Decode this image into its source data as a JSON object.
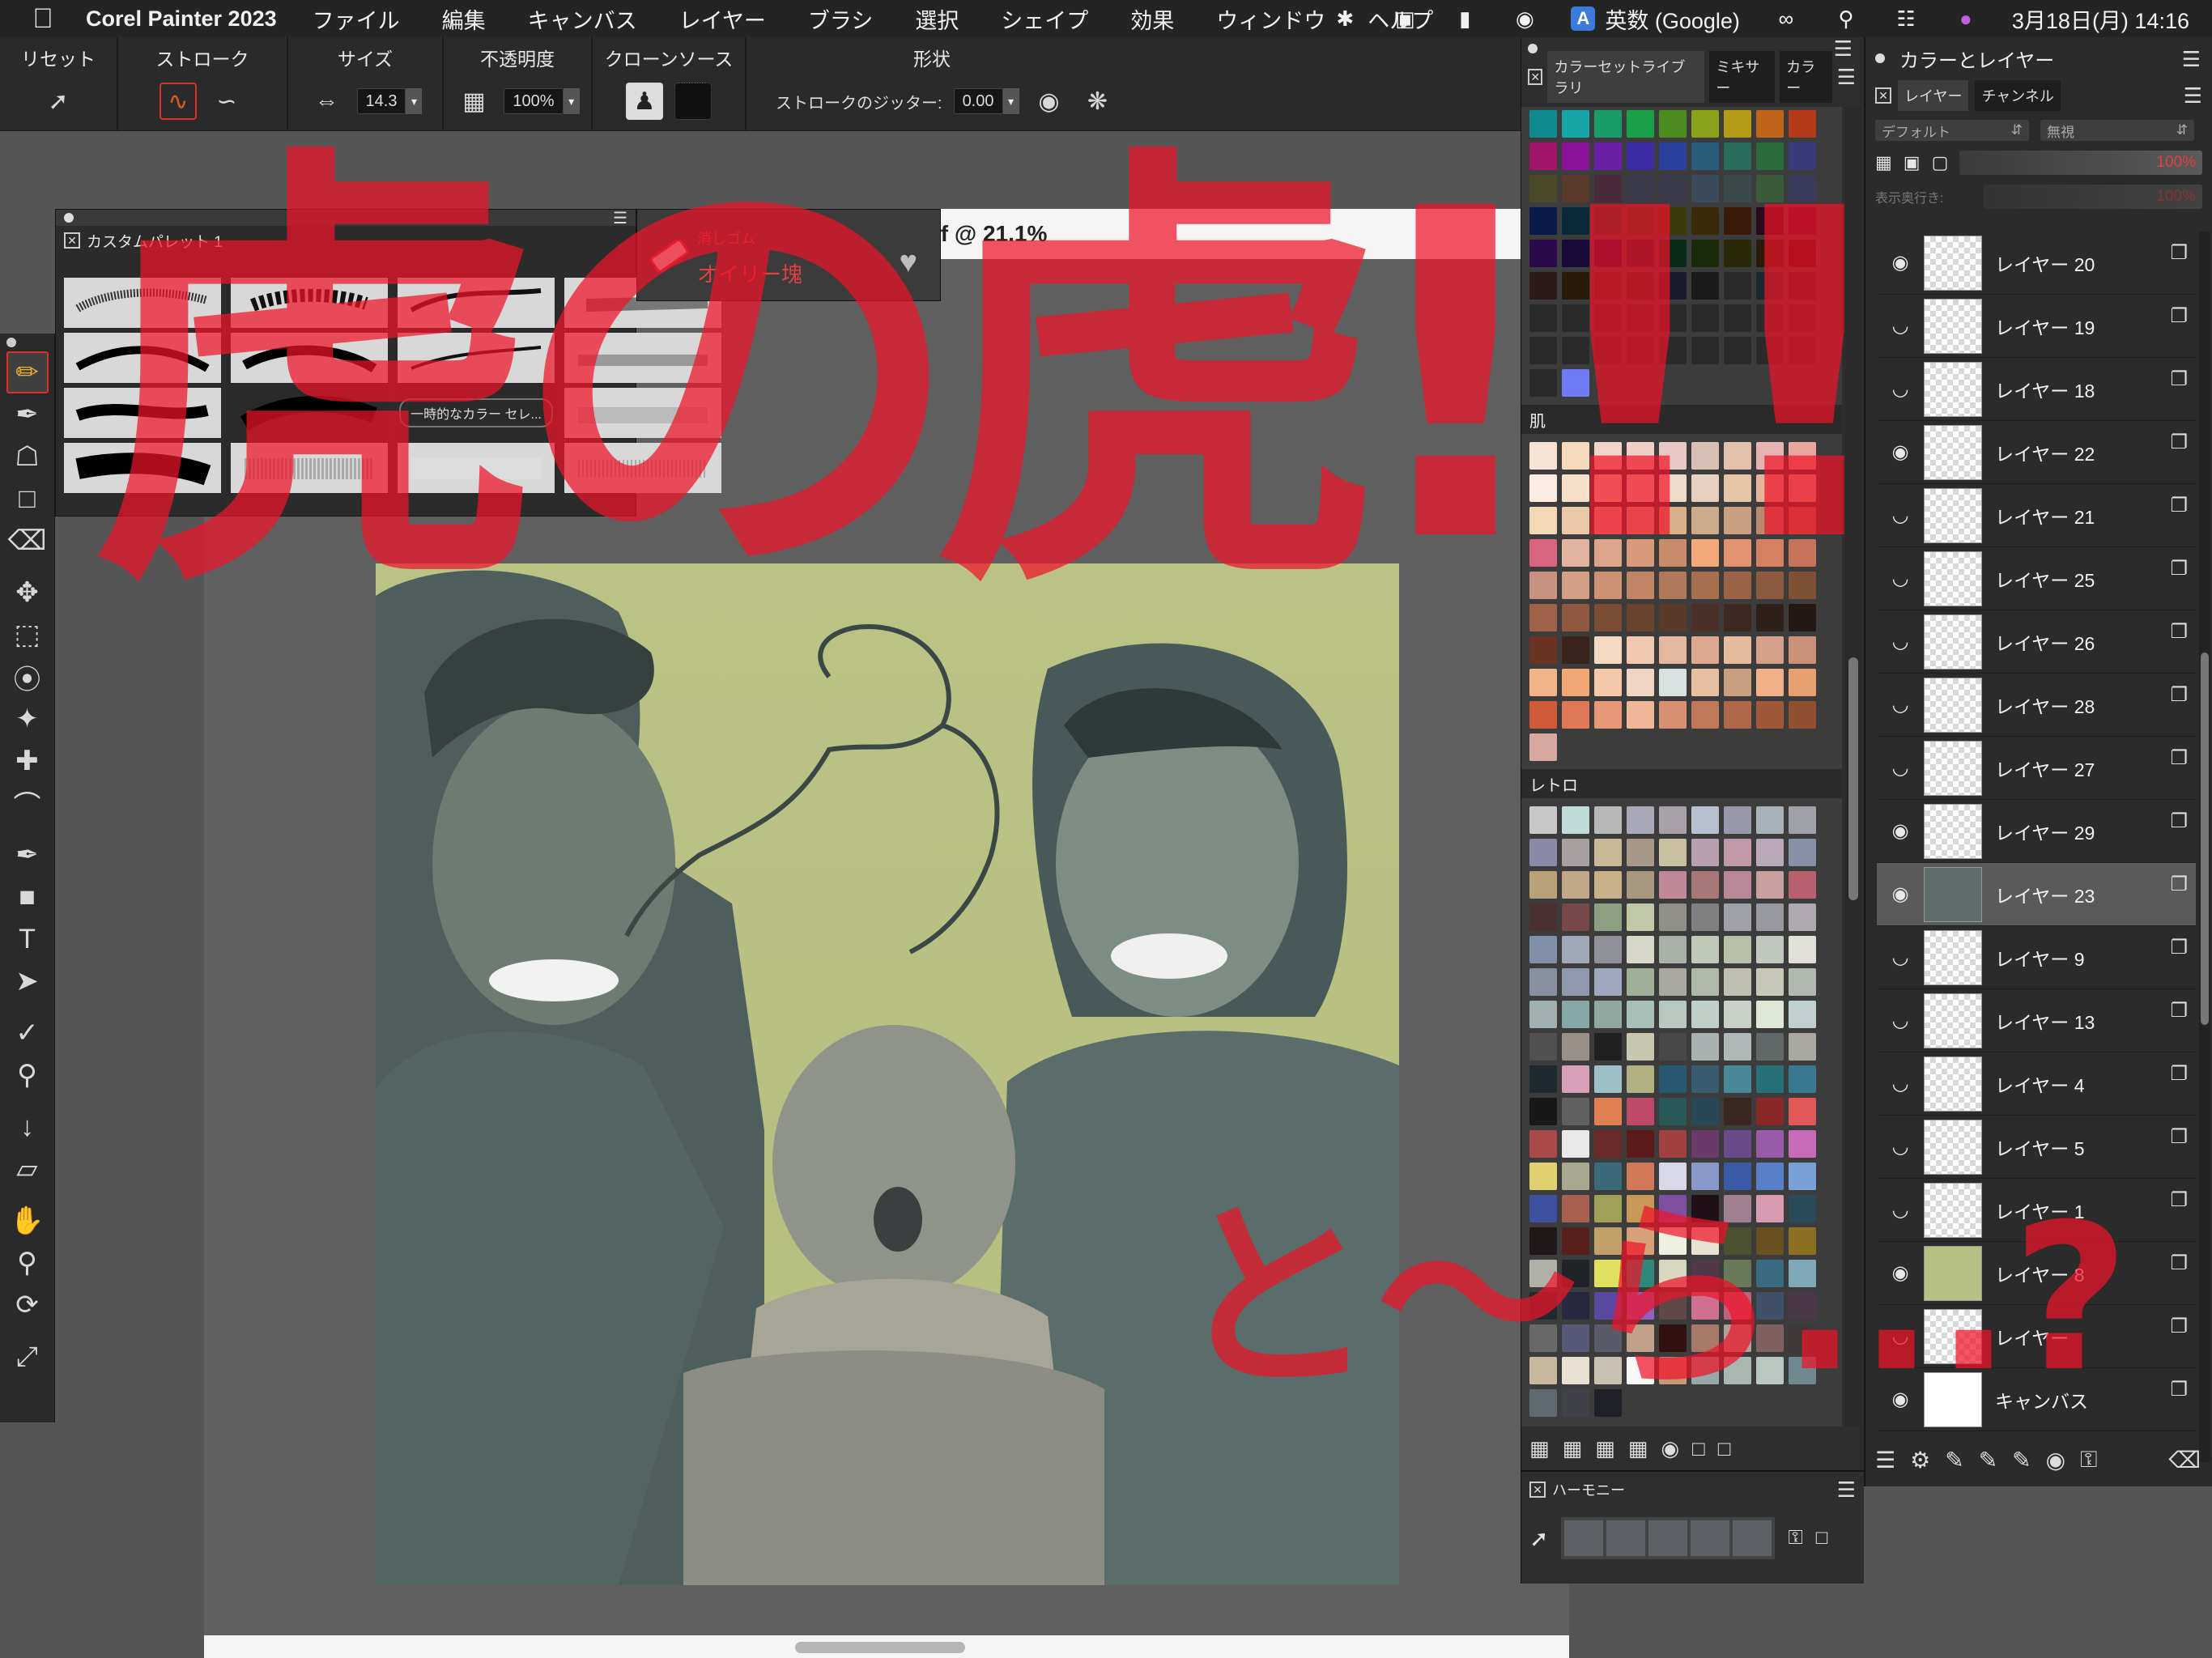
{
  "menubar": {
    "app_name": "Corel Painter 2023",
    "items": [
      "ファイル",
      "編集",
      "キャンバス",
      "レイヤー",
      "ブラシ",
      "選択",
      "シェイプ",
      "効果",
      "ウィンドウ",
      "ヘルプ"
    ],
    "ime_badge": "A",
    "ime_label": "英数 (Google)",
    "datetime": "3月18日(月)  14:16"
  },
  "property_bar": {
    "reset": "リセット",
    "stroke": "ストローク",
    "size": "サイズ",
    "size_value": "14.3",
    "opacity": "不透明度",
    "opacity_value": "100%",
    "clone_source": "クローンソース",
    "shape": "形状",
    "jitter_label": "ストロークのジッター:",
    "jitter_value": "0.00"
  },
  "custom_palette": {
    "title": "カスタムパレット 1",
    "button_label": "一時的なカラー セレ..."
  },
  "brush_selector": {
    "category": "消しゴム",
    "variant": "オイリー塊"
  },
  "document": {
    "title_fragment": "if @ 21.1%"
  },
  "color_library": {
    "tabs": [
      "カラーセットライブラリ",
      "ミキサー",
      "カラー"
    ],
    "section_skin": "肌",
    "section_retro": "レトロ",
    "colors": {
      "top": [
        "#0f8a8f",
        "#17a5a8",
        "#1a9b6a",
        "#1aa049",
        "#4d8c1f",
        "#8aa11a",
        "#b39b18",
        "#c1651a",
        "#b53a1a",
        "#a0146a",
        "#8a1499",
        "#6b1ea6",
        "#3d2ba6",
        "#2b3f9c",
        "#2a5c7c",
        "#2a6c5c",
        "#2a6c3c",
        "#3a3a7a",
        "#4a4a2a",
        "#5a3a2a",
        "#4a2a3a",
        "#3a3a4a",
        "#3a3a4a",
        "#3a4a5a",
        "#3a4a4a",
        "#3a5a3a",
        "#3a3a5a",
        "#0a1a4a",
        "#0a2a3a",
        "#0a3a2a",
        "#1a3a0a",
        "#3a3a0a",
        "#3a2a0a",
        "#3a1a0a",
        "#2a0a1a",
        "#3a0a2a",
        "#2a0a4a",
        "#1a0a3a",
        "#0a0a3a",
        "#0a1a2a",
        "#0a2a1a",
        "#1a2a0a",
        "#2a2a0a",
        "#2a1a0a",
        "#2a0a0a",
        "#2a1a1a",
        "#2a1a0a",
        "#2a2a1a",
        "#1a2a1a",
        "#1a1a2a",
        "#1a1a1a",
        "#2a2a2a",
        "#1a2a2a",
        "#2a1a2a",
        "#2a2a2a",
        "#2a2a2a",
        "#2a2a2a",
        "#2a2a2a",
        "#2a2a2a",
        "#2a2a2a",
        "#2a2a2a",
        "#2a2a2a",
        "#2a2a2a",
        "#2a2a2a",
        "#2a2a2a",
        "#2a2a2a",
        "#2a2a2a",
        "#2a2a2a",
        "#2a2a2a",
        "#2a2a2a",
        "#2a2a2a",
        "#2a2a2a",
        "#2a2a2a",
        "#6f7cf5"
      ],
      "skin": [
        "#f6e3d4",
        "#f5d9bd",
        "#f2d5c8",
        "#f0cfc6",
        "#e9c8c3",
        "#d9c0b4",
        "#e2c1ad",
        "#e6b3b3",
        "#e9a7a0",
        "#fbebe0",
        "#f7dec8",
        "#f4e6c0",
        "#f2dcc1",
        "#eedac8",
        "#e8d0c0",
        "#e6c6a8",
        "#e4b39a",
        "#ddb69c",
        "#f3d7b6",
        "#ecc9a6",
        "#e7c3a0",
        "#e1bfa0",
        "#d8b08a",
        "#ccaa8c",
        "#c9a082",
        "#b98a70",
        "#a57a5c",
        "#d8647f",
        "#e1b3a0",
        "#dca48a",
        "#d89a7a",
        "#c98c6a",
        "#f3a97a",
        "#e29270",
        "#d68062",
        "#c6735a",
        "#c89282",
        "#d3a085",
        "#cd9272",
        "#c18566",
        "#b07a5a",
        "#a6704e",
        "#9b6446",
        "#8c5a3e",
        "#7e5036",
        "#a0634a",
        "#8e573e",
        "#7c4d36",
        "#6a432e",
        "#58392a",
        "#4a3026",
        "#3c2820",
        "#30201a",
        "#241814",
        "#6a3222",
        "#3a241c",
        "#f3d8c4",
        "#f0c8b0",
        "#e4b8a0",
        "#dca890",
        "#e6bca0",
        "#d5a08a",
        "#c9907a",
        "#f1b38a",
        "#f2a875",
        "#f4c8a8",
        "#f0d4c4",
        "#d8e0e0",
        "#e8c0a0",
        "#c8a080",
        "#f0b088",
        "#e8a070",
        "#d05a3a",
        "#e07858",
        "#e89878",
        "#f0b898",
        "#d89070",
        "#c07858",
        "#b06848",
        "#a05838",
        "#905030",
        "#d8a8a0"
      ],
      "retro": [
        "#c8c8c8",
        "#c0dcd8",
        "#b8b8b8",
        "#a8a8b8",
        "#a8a0a8",
        "#b8c0d0",
        "#9898a8",
        "#a8b0b8",
        "#a0a0a8",
        "#8a8aa8",
        "#a8a0a0",
        "#c8b898",
        "#a89888",
        "#c8c0a0",
        "#b8a0b0",
        "#c098a8",
        "#b8a8b8",
        "#8890a8",
        "#b8a078",
        "#c0a888",
        "#c8b088",
        "#a89880",
        "#c08898",
        "#a87878",
        "#b88898",
        "#c8a0a0",
        "#b86070",
        "#4a3030",
        "#784848",
        "#8aa080",
        "#c0c8a8",
        "#909088",
        "#808080",
        "#a0a0a8",
        "#9898a0",
        "#b0a8b0",
        "#8090a8",
        "#a0a8b8",
        "#909098",
        "#d8d8c8",
        "#a8b0a8",
        "#c0c8b8",
        "#b8c0a8",
        "#c0c8c0",
        "#e0e0d8",
        "#8890a0",
        "#9098b0",
        "#a0a8c0",
        "#a0b098",
        "#a8a8a0",
        "#b0b8a8",
        "#c0c0b0",
        "#c8c8b8",
        "#b0b8b0",
        "#a0b0b0",
        "#88a8a8",
        "#90a8a0",
        "#a8c0b8",
        "#b8c8c0",
        "#c0d0c8",
        "#c8d0c8",
        "#e0e8d8",
        "#c0d0d0",
        "#505050",
        "#989088",
        "#202020",
        "#c8c8b0",
        "#484848",
        "#a8b0b0",
        "#b0b8b8",
        "#606868",
        "#a8a8a0",
        "#202830",
        "#d8a0b8",
        "#a0c0c8",
        "#b0b080",
        "#285870",
        "#3a5a70",
        "#4a8898",
        "#287078",
        "#3a7890",
        "#181818",
        "#606060",
        "#e08050",
        "#c04868",
        "#285858",
        "#284858",
        "#3a2820",
        "#8a2828",
        "#e05858",
        "#a84848",
        "#e8e8e8",
        "#6a2a2a",
        "#5a1a1a",
        "#a04040",
        "#6a3a6a",
        "#6a4a8a",
        "#9a5aaa",
        "#c86ab8",
        "#e0d070",
        "#a8a890",
        "#3a6a7a",
        "#d07858",
        "#d8d8e8",
        "#8898c8",
        "#3a5aa8",
        "#5880c8",
        "#7aa0d8",
        "#4050a0",
        "#a86050",
        "#a0a058",
        "#c89858",
        "#8050a0",
        "#201018",
        "#a08090",
        "#d89ab0",
        "#2a4a5a",
        "#201818",
        "#58201a",
        "#c0a068",
        "#d8a078",
        "#f0f0e0",
        "#e8e0d0",
        "#4a5030",
        "#6a5020",
        "#8a7020",
        "#b0b0a8",
        "#202428",
        "#e0e060",
        "#308878",
        "#d8d8c0",
        "#503848",
        "#6a7a58",
        "#3a6a80",
        "#80a8b8",
        "#202830",
        "#282840",
        "#5848a0",
        "#9060c0",
        "#604848",
        "#d07090",
        "#c06080",
        "#405068",
        "#4a3848",
        "#686868",
        "#585878",
        "#5a5a68",
        "#c0a088",
        "#301010",
        "#a87868",
        "#b0a098",
        "#806060",
        "#403838",
        "#c8b8a0",
        "#e8e0d0",
        "#c8c0b0",
        "#f8f8f8",
        "#c89878",
        "#98a8a8",
        "#a8b8b0",
        "#b8c8c0",
        "#708890",
        "#606870",
        "#404048",
        "#202028"
      ]
    }
  },
  "harmony": {
    "title": "ハーモニー"
  },
  "layers_panel": {
    "title": "カラーとレイヤー",
    "tabs": [
      "レイヤー",
      "チャンネル"
    ],
    "composite_method": "デフォルト",
    "preserve": "無視",
    "opacity": "100%",
    "depth_label": "表示奥行き:",
    "depth_value": "100%",
    "layers": [
      {
        "name": "レイヤー 20",
        "visible": true
      },
      {
        "name": "レイヤー 19",
        "visible": false
      },
      {
        "name": "レイヤー 18",
        "visible": false
      },
      {
        "name": "レイヤー 22",
        "visible": true
      },
      {
        "name": "レイヤー 21",
        "visible": false
      },
      {
        "name": "レイヤー 25",
        "visible": false
      },
      {
        "name": "レイヤー 26",
        "visible": false
      },
      {
        "name": "レイヤー 28",
        "visible": false
      },
      {
        "name": "レイヤー 27",
        "visible": false
      },
      {
        "name": "レイヤー 29",
        "visible": true
      },
      {
        "name": "レイヤー 23",
        "visible": true,
        "selected": true
      },
      {
        "name": "レイヤー 9",
        "visible": false
      },
      {
        "name": "レイヤー 13",
        "visible": false
      },
      {
        "name": "レイヤー 4",
        "visible": false
      },
      {
        "name": "レイヤー 5",
        "visible": false
      },
      {
        "name": "レイヤー 1",
        "visible": false
      },
      {
        "name": "レイヤー 8",
        "visible": true
      },
      {
        "name": "レイヤー",
        "visible": false
      },
      {
        "name": "キャンバス",
        "visible": true
      }
    ]
  },
  "annotation": {
    "top_text": "虎の虎!!!",
    "bottom_text": "と〜ら...?"
  }
}
